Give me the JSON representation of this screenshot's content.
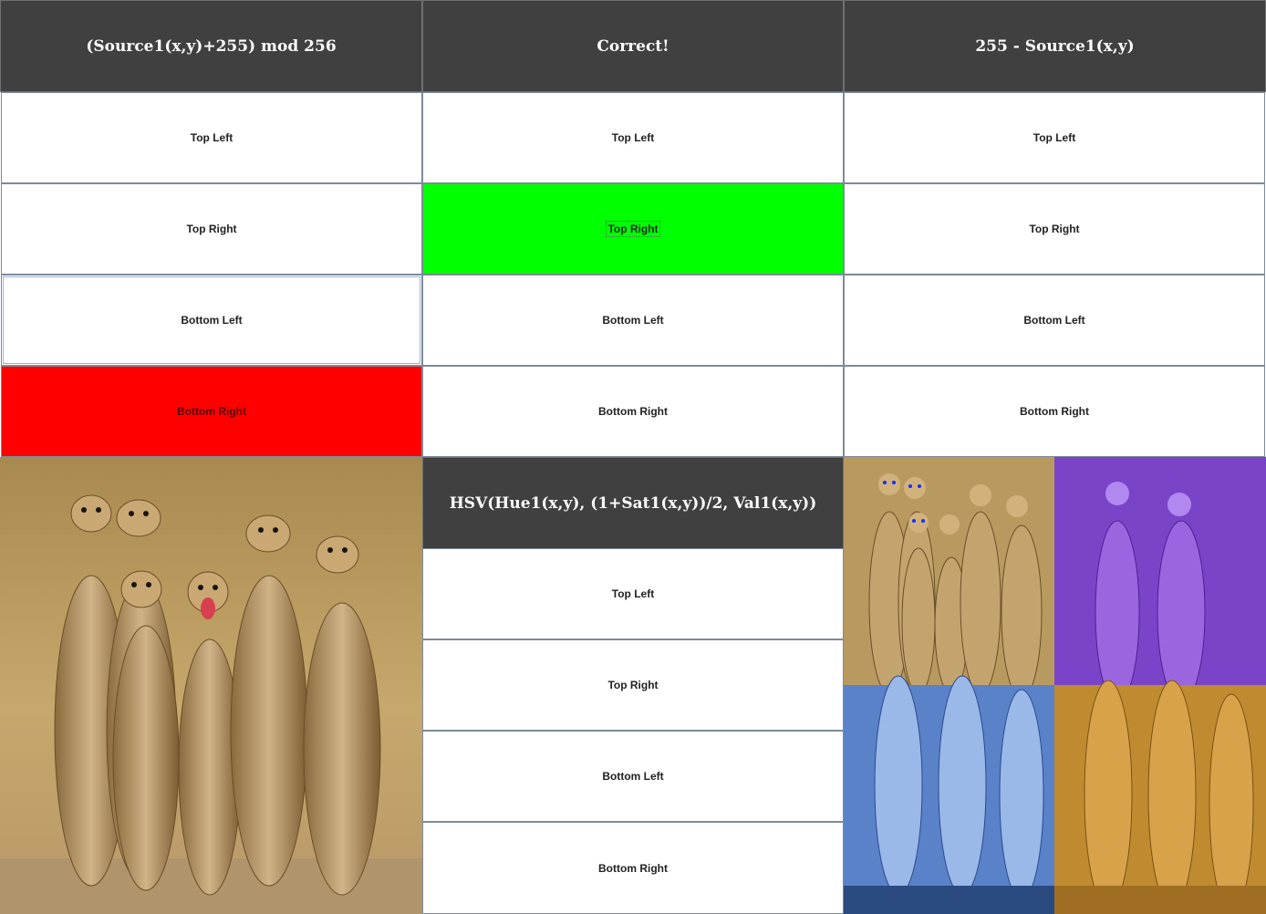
{
  "colors": {
    "header_bg": "#404040",
    "correct_green": "#00ff00",
    "wrong_red": "#ff0000",
    "button_border": "#7d8a98",
    "purple_tint": "#8a4fd6",
    "blue_tint": "#4a78c8",
    "orange_tint": "#c88a2a"
  },
  "col1": {
    "title": "(Source1(x,y)+255) mod 256",
    "options": [
      "Top Left",
      "Top Right",
      "Bottom Left",
      "Bottom Right"
    ],
    "image": "meerkats-photo"
  },
  "col2": {
    "title": "Correct!",
    "options": [
      "Top Left",
      "Top Right",
      "Bottom Left",
      "Bottom Right"
    ],
    "title2": "HSV(Hue1(x,y), (1+Sat1(x,y))/2, Val1(x,y))",
    "options2": [
      "Top Left",
      "Top Right",
      "Bottom Left",
      "Bottom Right"
    ]
  },
  "col3": {
    "title": "255 - Source1(x,y)",
    "options": [
      "Top Left",
      "Top Right",
      "Bottom Left",
      "Bottom Right"
    ],
    "image": "meerkats-four-quadrant-variants"
  }
}
